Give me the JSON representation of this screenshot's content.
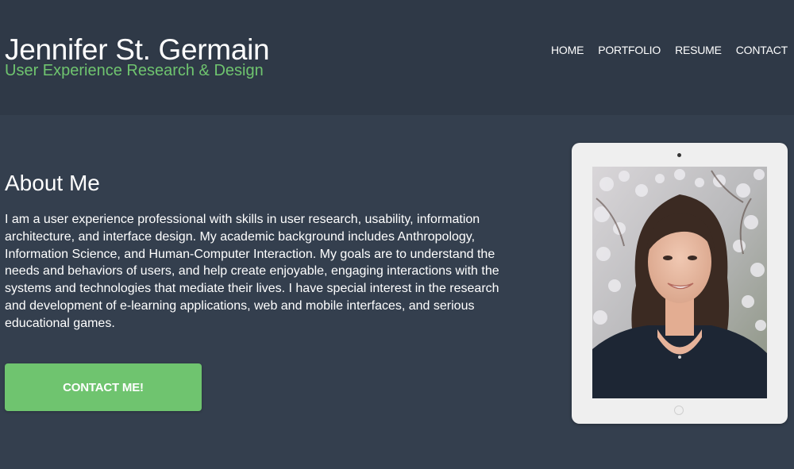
{
  "header": {
    "title": "Jennifer St. Germain",
    "subtitle": "User Experience Research & Design",
    "nav": [
      {
        "label": "HOME"
      },
      {
        "label": "PORTFOLIO"
      },
      {
        "label": "RESUME"
      },
      {
        "label": "CONTACT"
      }
    ]
  },
  "about": {
    "heading": "About Me",
    "body": "I am a user experience professional with skills in user research, usability, information architecture, and interface design. My academic background includes Anthropology, Information Science, and Human-Computer Interaction. My goals are to understand the needs and behaviors of users, and help create enjoyable, engaging interactions with the systems and technologies that mediate their lives. I have special interest in the research and development of e-learning applications, web and mobile interfaces, and serious educational games.",
    "cta_label": "CONTACT ME!"
  },
  "colors": {
    "background": "#343f4e",
    "header_background": "#2f3947",
    "accent": "#6fc46f",
    "text": "#ffffff"
  },
  "icons": {
    "tablet_home_button": "home-button-icon",
    "tablet_camera": "camera-icon"
  }
}
